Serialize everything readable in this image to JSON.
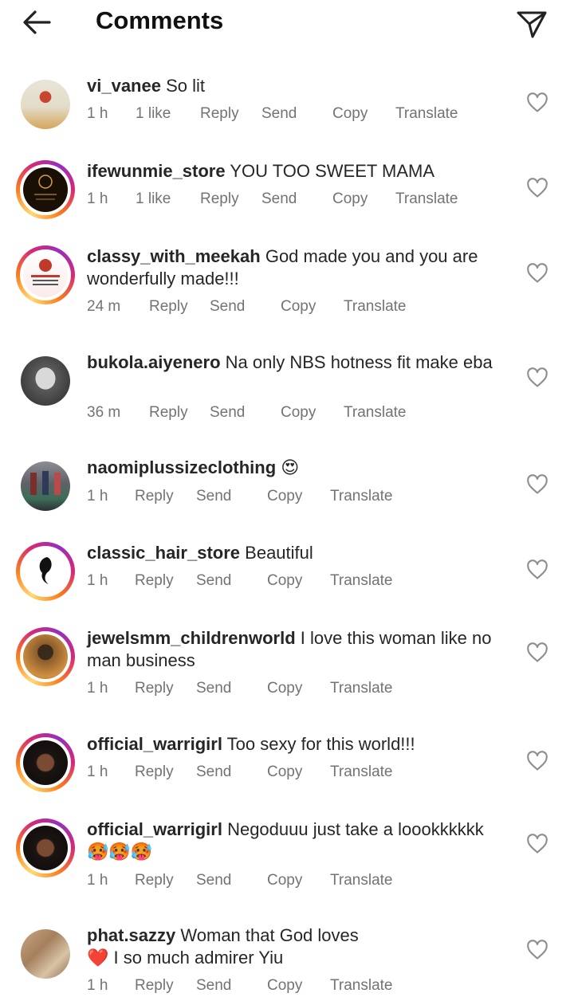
{
  "header": {
    "title": "Comments",
    "back_icon": "arrow-left-icon",
    "share_icon": "paper-plane-icon"
  },
  "colors": {
    "ring_gradient": [
      "#feda75",
      "#fa7e1e",
      "#d62976",
      "#962fbf"
    ],
    "meta_text": "#737373",
    "text": "#262626"
  },
  "comments": [
    {
      "user": "vi_vanee",
      "text": "So lit",
      "time": "1 h",
      "likes": "1 like",
      "reply": "Reply",
      "send": "Send",
      "copy": "Copy",
      "translate": "Translate",
      "has_story_ring": false
    },
    {
      "user": "ifewunmie_store",
      "text": "YOU TOO SWEET MAMA",
      "time": "1 h",
      "likes": "1 like",
      "reply": "Reply",
      "send": "Send",
      "copy": "Copy",
      "translate": "Translate",
      "has_story_ring": true
    },
    {
      "user": "classy_with_meekah",
      "text": "God made you and you are wonderfully made!!!",
      "time": "24 m",
      "reply": "Reply",
      "send": "Send",
      "copy": "Copy",
      "translate": "Translate",
      "has_story_ring": true
    },
    {
      "user": "bukola.aiyenero",
      "text": "Na only NBS hotness fit make eba",
      "time": "36 m",
      "reply": "Reply",
      "send": "Send",
      "copy": "Copy",
      "translate": "Translate",
      "has_story_ring": false
    },
    {
      "user": "naomiplussizeclothing",
      "text": "😍",
      "time": "1 h",
      "reply": "Reply",
      "send": "Send",
      "copy": "Copy",
      "translate": "Translate",
      "has_story_ring": false
    },
    {
      "user": "classic_hair_store",
      "text": "Beautiful",
      "time": "1 h",
      "reply": "Reply",
      "send": "Send",
      "copy": "Copy",
      "translate": "Translate",
      "has_story_ring": true
    },
    {
      "user": "jewelsmm_childrenworld",
      "text": "I love this woman like no man business",
      "time": "1 h",
      "reply": "Reply",
      "send": "Send",
      "copy": "Copy",
      "translate": "Translate",
      "has_story_ring": true
    },
    {
      "user": "official_warrigirl",
      "text": "Too sexy for this world!!!",
      "time": "1 h",
      "reply": "Reply",
      "send": "Send",
      "copy": "Copy",
      "translate": "Translate",
      "has_story_ring": true
    },
    {
      "user": "official_warrigirl",
      "text": "Negoduuu just take a loookkkkkk",
      "text2": "🥵🥵🥵",
      "time": "1 h",
      "reply": "Reply",
      "send": "Send",
      "copy": "Copy",
      "translate": "Translate",
      "has_story_ring": true
    },
    {
      "user": "phat.sazzy",
      "text": "Woman that God loves",
      "text2": "❤️ I so much admirer Yiu",
      "time": "1 h",
      "reply": "Reply",
      "send": "Send",
      "copy": "Copy",
      "translate": "Translate",
      "has_story_ring": false
    }
  ]
}
